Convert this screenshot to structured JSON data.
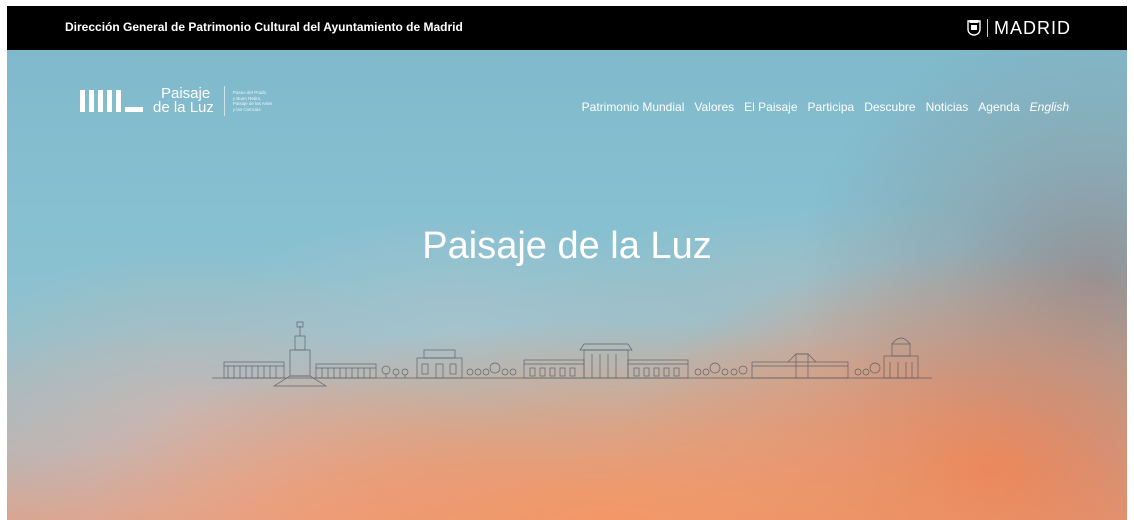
{
  "topbar": {
    "department": "Dirección General de Patrimonio Cultural del Ayuntamiento de Madrid",
    "city_brand": "MADRID",
    "crest_icon": "madrid-crest-icon"
  },
  "logo": {
    "line1": "Paisaje",
    "line2": "de la Luz",
    "subtitle_lines": [
      "Paseo del Prado",
      "y Buen Retiro,",
      "Paisaje de las Artes",
      "y las Ciencias"
    ]
  },
  "nav": {
    "items": [
      "Patrimonio Mundial",
      "Valores",
      "El Paisaje",
      "Participa",
      "Descubre",
      "Noticias",
      "Agenda"
    ],
    "language": "English"
  },
  "hero": {
    "title": "Paisaje de la Luz",
    "illustration_icon": "skyline-illustration",
    "colors": {
      "sky": "#86c0d1",
      "sunset": "#f0966a",
      "text": "#ffffff"
    }
  }
}
